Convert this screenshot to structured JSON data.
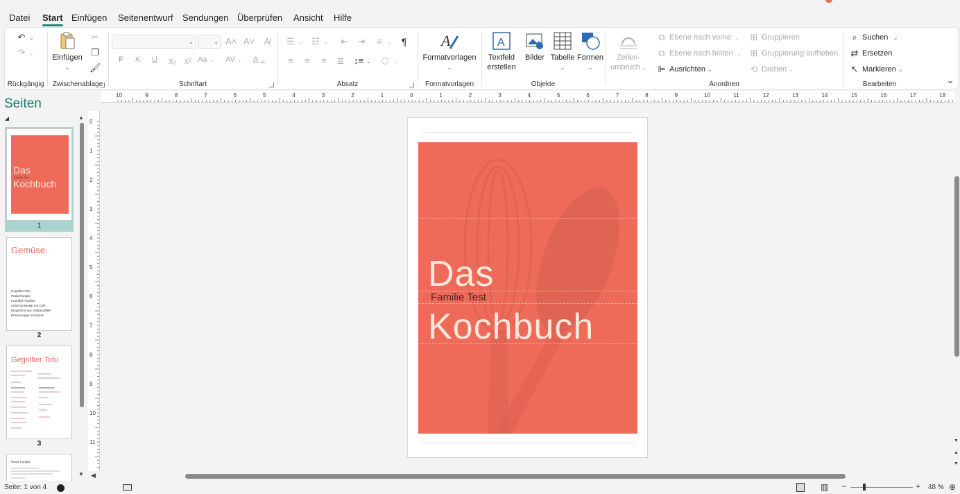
{
  "menu": {
    "tabs": [
      {
        "label": "Datei"
      },
      {
        "label": "Start",
        "active": true
      },
      {
        "label": "Einfügen"
      },
      {
        "label": "Seitenentwurf"
      },
      {
        "label": "Sendungen"
      },
      {
        "label": "Überprüfen"
      },
      {
        "label": "Ansicht"
      },
      {
        "label": "Hilfe"
      }
    ]
  },
  "ribbon": {
    "undo": {
      "label": "Rückgängig"
    },
    "clipboard": {
      "label": "Zwischenablage",
      "paste": "Einfügen"
    },
    "font": {
      "label": "Schriftart",
      "bold": "F",
      "italic": "K",
      "underline": "U",
      "case": "Aa",
      "spacing": "AV",
      "color": "A"
    },
    "paragraph": {
      "label": "Absatz",
      "pilcrow": "¶"
    },
    "styles": {
      "label": "Formatvorlagen",
      "button": "Formatvorlagen"
    },
    "objects": {
      "label": "Objekte",
      "textbox_line1": "Textfeld",
      "textbox_line2": "erstellen",
      "pictures": "Bilder",
      "table": "Tabelle",
      "shapes": "Formen"
    },
    "arrange": {
      "label": "Anordnen",
      "wrap_line1": "Zeilen-",
      "wrap_line2": "umbruch",
      "bring_forward": "Ebene nach vorne",
      "send_backward": "Ebene nach hinten",
      "align": "Ausrichten",
      "group": "Gruppieren",
      "ungroup": "Gruppierung aufheben",
      "rotate": "Drehen"
    },
    "editing": {
      "label": "Bearbeiten",
      "find": "Suchen",
      "replace": "Ersetzen",
      "select": "Markieren"
    }
  },
  "pages_pane": {
    "title": "Seiten",
    "thumbnails": [
      {
        "number": "1",
        "title_line1": "Das",
        "subtitle": "Familie Test",
        "title_line2": "Kochbuch"
      },
      {
        "number": "2",
        "title": "Gemüse",
        "items": [
          "Gegrillter Tofu",
          "Pasta Fungini",
          "Curtoffel Paralina",
          "Artischockendip mit Chili",
          "Burgerbrot aus Süßkartoffeln",
          "Erbsensuppe mit Minze"
        ]
      },
      {
        "number": "3",
        "title": "Gegrillter Tofu"
      },
      {
        "number": "4",
        "title": "Pasta Fungini"
      }
    ]
  },
  "rulers": {
    "h_labels": [
      "10",
      "9",
      "8",
      "7",
      "6",
      "5",
      "4",
      "3",
      "2",
      "1",
      "0",
      "1",
      "2",
      "3",
      "4",
      "5",
      "6",
      "7",
      "8",
      "9",
      "10",
      "11",
      "12",
      "13",
      "14",
      "15",
      "16",
      "17",
      "18"
    ],
    "v_labels": [
      "0",
      "1",
      "2",
      "3",
      "4",
      "5",
      "6",
      "7",
      "8",
      "9",
      "10",
      "11"
    ]
  },
  "document": {
    "title_line1": "Das",
    "subtitle": "Familie Test",
    "title_line2": "Kochbuch",
    "cover_color": "#ee6b5a",
    "title_color": "#fbe8da"
  },
  "statusbar": {
    "page_info": "Seite: 1 von 4",
    "zoom_percent": "48 %",
    "zoom_minus": "−",
    "zoom_plus": "+"
  },
  "colors": {
    "accent": "#1b8a7d",
    "pane_title": "#1b7a70",
    "selection": "#a9d3cd"
  }
}
